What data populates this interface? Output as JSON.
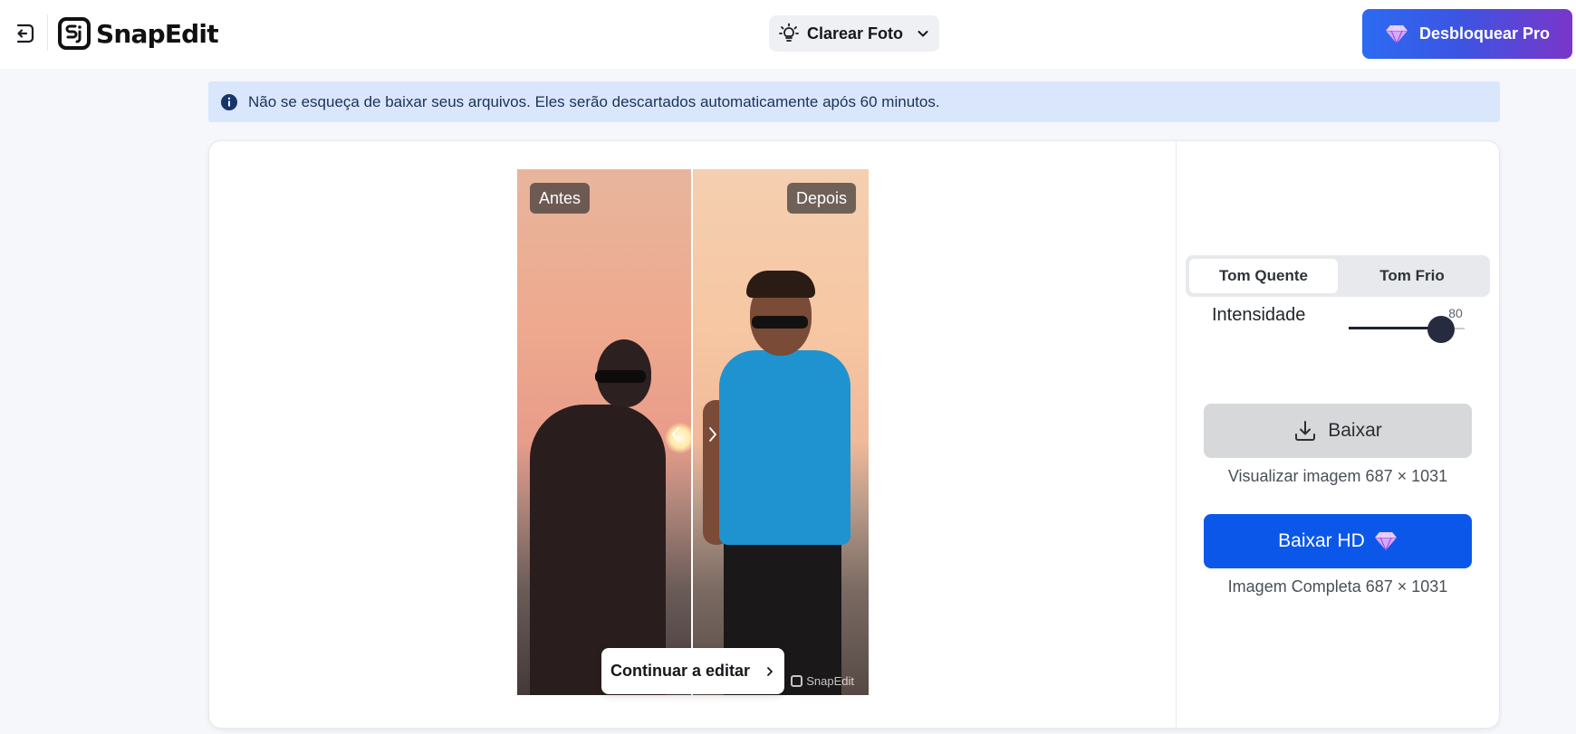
{
  "header": {
    "logo_text": "SnapEdit",
    "tool_select_label": "Clarear Foto",
    "pro_button_label": "Desbloquear Pro"
  },
  "notice": {
    "text": "Não se esqueça de baixar seus arquivos. Eles serão descartados automaticamente após 60 minutos."
  },
  "preview": {
    "before_label": "Antes",
    "after_label": "Depois",
    "watermark": "SnapEdit",
    "continue_label": "Continuar a editar"
  },
  "panel": {
    "tones": [
      "Tom Quente",
      "Tom Frio"
    ],
    "active_tone": "Tom Quente",
    "intensity_label": "Intensidade",
    "intensity_value": "80",
    "intensity_max": 100,
    "download_label": "Baixar",
    "download_info": "Visualizar imagem 687 × 1031",
    "hd_label": "Baixar HD",
    "hd_info": "Imagem Completa 687 × 1031"
  },
  "colors": {
    "accent_blue": "#0b57ea",
    "notice_bg": "#d9e6fc",
    "pro_gradient_start": "#2c6bf2",
    "pro_gradient_end": "#7a36c9"
  }
}
